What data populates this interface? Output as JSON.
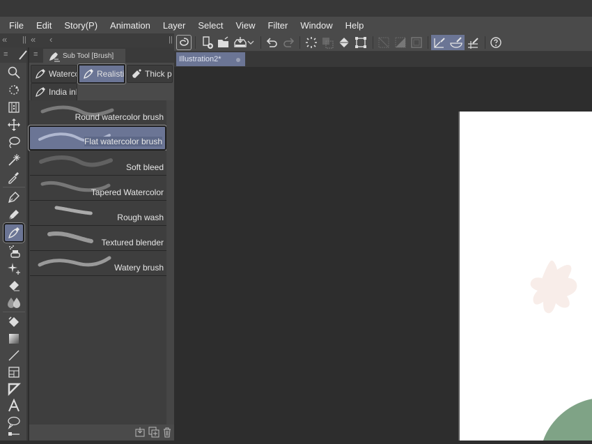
{
  "menu": [
    "File",
    "Edit",
    "Story(P)",
    "Animation",
    "Layer",
    "Select",
    "View",
    "Filter",
    "Window",
    "Help"
  ],
  "panel_strip": {
    "collapse_all": "«",
    "grip": "||",
    "collapse": "«",
    "back": "‹",
    "grip_right": "||"
  },
  "toolbar": {
    "buttons": [
      {
        "name": "clip-studio-icon",
        "active": false
      },
      {
        "name": "new-canvas-icon",
        "active": false
      },
      {
        "name": "open-folder-icon",
        "active": false
      },
      {
        "name": "save-icon",
        "active": false
      },
      {
        "name": "save-dropdown-icon",
        "active": false
      },
      {
        "name": "undo-icon",
        "active": false
      },
      {
        "name": "redo-icon",
        "active": false,
        "disabled": true
      },
      {
        "name": "clear-selection-icon",
        "active": false
      },
      {
        "name": "invert-selection-icon",
        "active": false,
        "disabled": true
      },
      {
        "name": "fill-icon",
        "active": false
      },
      {
        "name": "transform-icon",
        "active": false
      },
      {
        "name": "hide-selection-icon",
        "active": false,
        "disabled": true
      },
      {
        "name": "clip-icon",
        "active": false,
        "disabled": true
      },
      {
        "name": "border-icon",
        "active": false,
        "disabled": true
      },
      {
        "name": "ruler-snap-icon",
        "active": true
      },
      {
        "name": "special-ruler-snap-icon",
        "active": true
      },
      {
        "name": "grid-snap-icon",
        "active": false
      },
      {
        "name": "help-icon",
        "active": false
      }
    ]
  },
  "document_tab": {
    "title": "Illustration2*"
  },
  "subtool_panel": {
    "title": "Sub Tool [Brush]",
    "groups": [
      {
        "label": "Waterco",
        "active": false
      },
      {
        "label": "Realistic",
        "active": true
      },
      {
        "label": "Thick pa",
        "active": false
      },
      {
        "label": "India ink",
        "active": false
      }
    ],
    "items": [
      {
        "label": "Round watercolor brush",
        "active": false
      },
      {
        "label": "Flat watercolor brush",
        "active": true
      },
      {
        "label": "Soft bleed",
        "active": false
      },
      {
        "label": "Tapered Watercolor",
        "active": false
      },
      {
        "label": "Rough wash",
        "active": false
      },
      {
        "label": "Textured blender",
        "active": false
      },
      {
        "label": "Watery brush",
        "active": false
      }
    ]
  },
  "tools": [
    "zoom",
    "operation",
    "move-layer",
    "move",
    "lasso",
    "auto-select",
    "eyedropper",
    "pen",
    "pencil",
    "brush",
    "airbrush",
    "decoration",
    "eraser",
    "blend",
    "fill",
    "gradient",
    "figure",
    "frame-border",
    "ruler",
    "text",
    "balloon",
    "line-correction"
  ],
  "active_tool": "brush",
  "colors": {
    "accent": "#6b7595",
    "menubar": "#4a4a4a",
    "canvas_bg": "#2d2d2d",
    "paper": "#ffffff",
    "flower": "#f8ede9",
    "leaf": "#7fa386"
  }
}
